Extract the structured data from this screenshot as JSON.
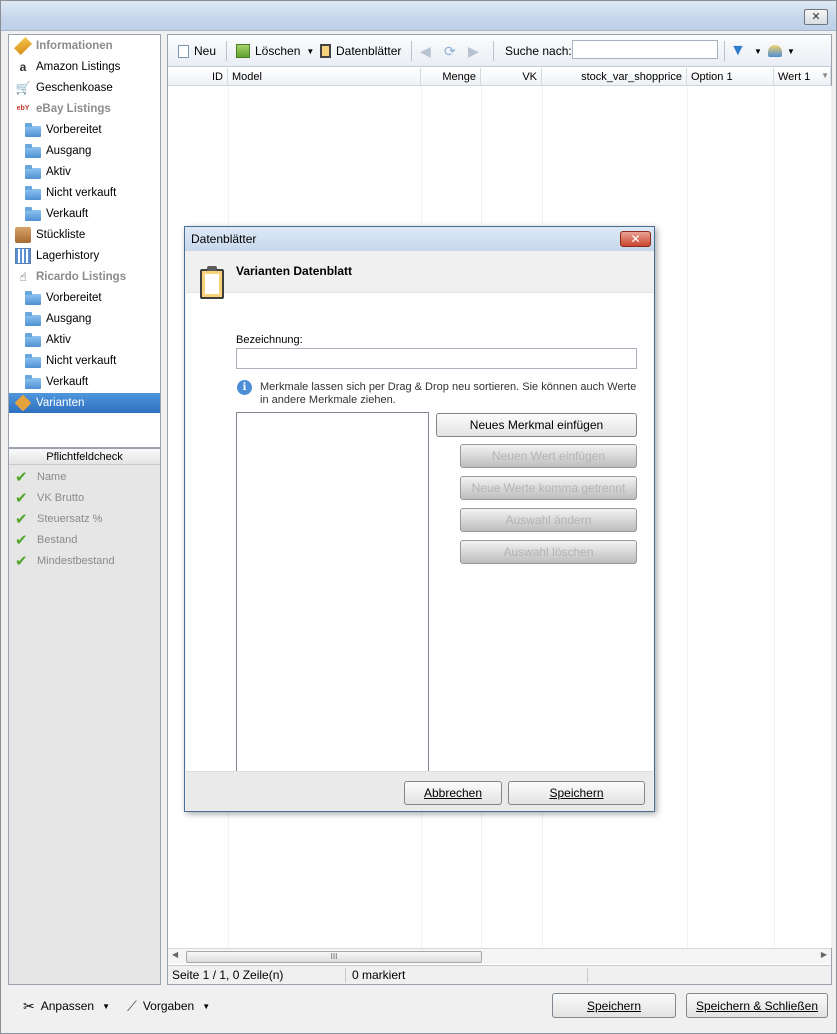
{
  "window": {
    "close_glyph": "✕"
  },
  "sidebar": {
    "items": [
      {
        "label": "Informationen",
        "icon": "pencil-icon",
        "kind": "group"
      },
      {
        "label": "Amazon Listings",
        "icon": "amazon-icon",
        "kind": "item"
      },
      {
        "label": "Geschenkoase",
        "icon": "cart-icon",
        "kind": "item"
      },
      {
        "label": "eBay Listings",
        "icon": "ebay-icon",
        "kind": "group"
      },
      {
        "label": "Vorbereitet",
        "icon": "folder-icon",
        "kind": "sub"
      },
      {
        "label": "Ausgang",
        "icon": "folder-icon",
        "kind": "sub"
      },
      {
        "label": "Aktiv",
        "icon": "folder-icon",
        "kind": "sub"
      },
      {
        "label": "Nicht verkauft",
        "icon": "folder-icon",
        "kind": "sub"
      },
      {
        "label": "Verkauft",
        "icon": "folder-icon",
        "kind": "sub"
      },
      {
        "label": "Stückliste",
        "icon": "box-icon",
        "kind": "item"
      },
      {
        "label": "Lagerhistory",
        "icon": "chart-icon",
        "kind": "item"
      },
      {
        "label": "Ricardo Listings",
        "icon": "hand-icon",
        "kind": "group"
      },
      {
        "label": "Vorbereitet",
        "icon": "folder-icon",
        "kind": "sub"
      },
      {
        "label": "Ausgang",
        "icon": "folder-icon",
        "kind": "sub"
      },
      {
        "label": "Aktiv",
        "icon": "folder-icon",
        "kind": "sub"
      },
      {
        "label": "Nicht verkauft",
        "icon": "folder-icon",
        "kind": "sub"
      },
      {
        "label": "Verkauft",
        "icon": "folder-icon",
        "kind": "sub"
      },
      {
        "label": "Varianten",
        "icon": "tag-icon",
        "kind": "selected"
      }
    ]
  },
  "pflichtfeldcheck": {
    "title": "Pflichtfeldcheck",
    "items": [
      "Name",
      "VK Brutto",
      "Steuersatz %",
      "Bestand",
      "Mindestbestand"
    ]
  },
  "toolbar": {
    "new_label": "Neu",
    "delete_label": "Löschen",
    "datasheets_label": "Datenblätter",
    "search_label": "Suche nach:",
    "search_value": ""
  },
  "grid": {
    "columns": [
      "ID",
      "Model",
      "Menge",
      "VK",
      "stock_var_shopprice",
      "Option 1",
      "Wert 1"
    ]
  },
  "scroll": {
    "thumb_glyph": "III"
  },
  "status": {
    "page": "Seite 1 / 1, 0 Zeile(n)",
    "marked": "0 markiert"
  },
  "bottom": {
    "customize_label": "Anpassen",
    "defaults_label": "Vorgaben",
    "save_label": "Speichern",
    "save_close_label": "Speichern & Schließen"
  },
  "dialog": {
    "title": "Datenblätter",
    "close_glyph": "✕",
    "header": "Varianten Datenblatt",
    "name_label": "Bezeichnung:",
    "name_value": "",
    "info_text_1": "Merkmale lassen sich per Drag & Drop neu sortieren. Sie können auch Werte",
    "info_text_2": "in andere Merkmale ziehen.",
    "buttons": {
      "new_feature": "Neues Merkmal einfügen",
      "new_value": "Neuen Wert einfügen",
      "new_values_comma": "Neue Werte komma getrennt",
      "edit_selection": "Auswahl ändern",
      "delete_selection": "Auswahl löschen"
    },
    "cancel_label": "Abbrechen",
    "save_label": "Speichern"
  },
  "colors": {
    "selection": "#2e6fbf",
    "check_green": "#52a62c",
    "dialog_close": "#c8462f"
  }
}
